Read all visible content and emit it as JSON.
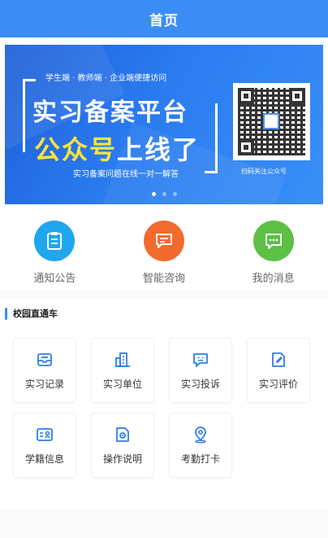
{
  "header": {
    "title": "首页"
  },
  "banner": {
    "subtitle": "学生端 · 教师端 · 企业端便捷访问",
    "title_line1": "实习备案平台",
    "title_line2_yellow": "公众号",
    "title_line2_white": "上线了",
    "footer": "实习备案问题在线一对一解答",
    "qr_caption": "扫码关注公众号",
    "slide_count": 3,
    "active_slide": 1
  },
  "quick_actions": [
    {
      "label": "通知公告",
      "icon": "notice-icon",
      "color": "#1fa6ef"
    },
    {
      "label": "智能咨询",
      "icon": "chat-icon",
      "color": "#f26b2c"
    },
    {
      "label": "我的消息",
      "icon": "message-icon",
      "color": "#5bc043"
    }
  ],
  "section": {
    "title": "校园直通车"
  },
  "tiles": [
    {
      "label": "实习记录",
      "icon": "record-icon"
    },
    {
      "label": "实习单位",
      "icon": "building-icon"
    },
    {
      "label": "实习投诉",
      "icon": "complaint-icon"
    },
    {
      "label": "实习评价",
      "icon": "evaluation-icon"
    },
    {
      "label": "学籍信息",
      "icon": "student-id-icon"
    },
    {
      "label": "操作说明",
      "icon": "instructions-icon"
    },
    {
      "label": "考勤打卡",
      "icon": "location-pin-icon"
    }
  ],
  "colors": {
    "accent": "#3b8df5",
    "icon_blue": "#2e7de6"
  }
}
